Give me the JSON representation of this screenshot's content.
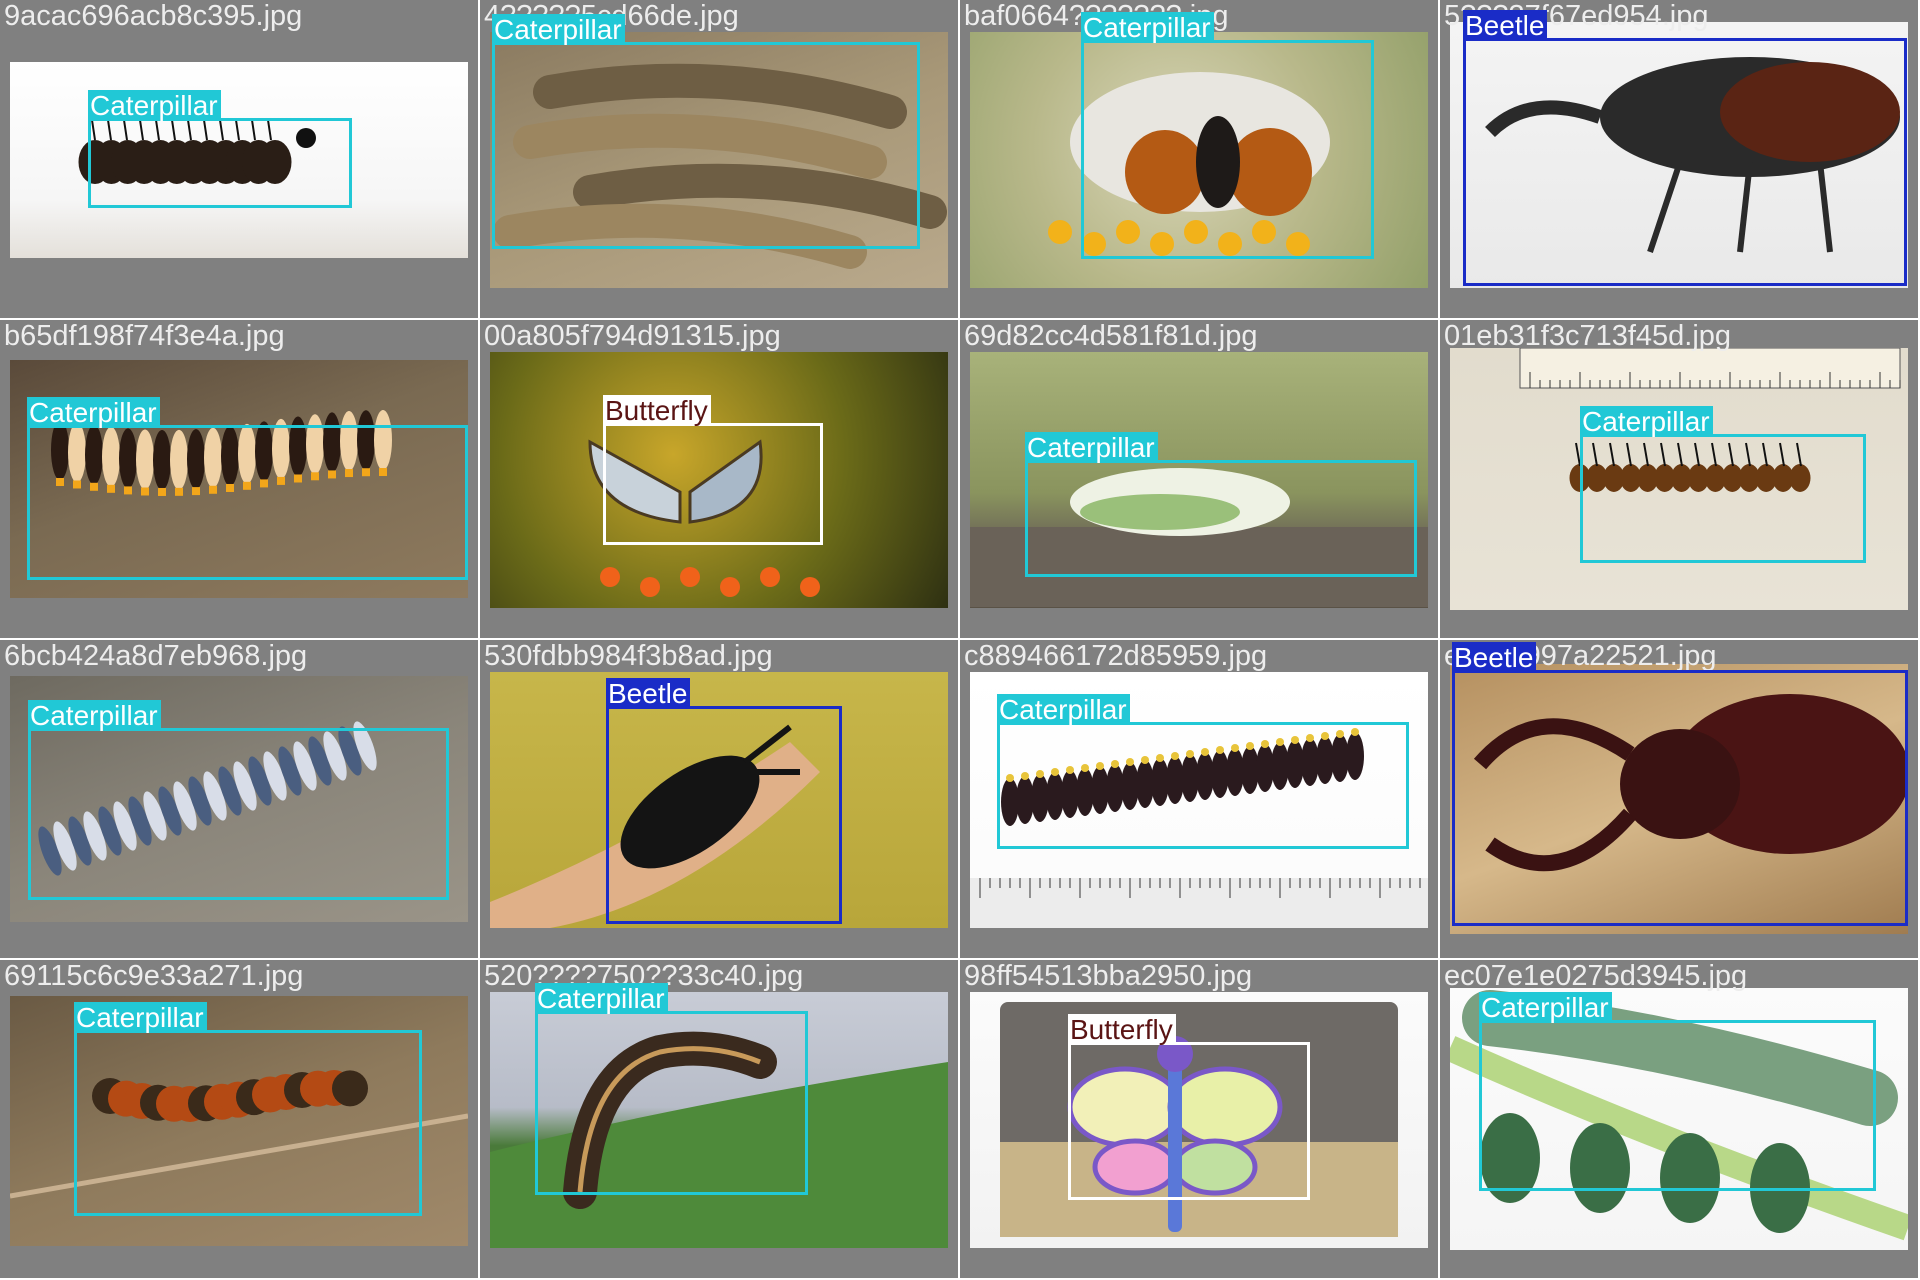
{
  "class_styles": {
    "Caterpillar": {
      "box": "#21c8d6",
      "label_bg": "#21c8d6",
      "label_fg": "#ffffff"
    },
    "Butterfly": {
      "box": "#ffffff",
      "label_bg": "#ffffff",
      "label_fg": "#5a1414"
    },
    "Beetle": {
      "box": "#1a2cc7",
      "label_bg": "#1a2cc7",
      "label_fg": "#ffffff"
    }
  },
  "tiles": [
    {
      "file": "9acac696acb8c395.jpg",
      "bg": "linear-gradient(180deg,#ffffff 0%,#f6f6f6 70%,#e4e0da 100%)",
      "subject": "spiky-caterpillar",
      "detections": [
        {
          "label": "Caterpillar"
        }
      ]
    },
    {
      "file": "4?????5cd66de.jpg",
      "bg": "linear-gradient(160deg,#8a7a60 0%,#a89878 50%,#b9a98c 100%)",
      "subject": "caterpillar-cluster",
      "detections": [
        {
          "label": "Caterpillar"
        }
      ]
    },
    {
      "file": "baf0664???????.jpg",
      "bg": "radial-gradient(circle at 45% 45%,#d9d6b8 0%,#b8b88a 50%,#93a06a 100%)",
      "subject": "woolly-caterpillar",
      "detections": [
        {
          "label": "Caterpillar"
        }
      ]
    },
    {
      "file": "5???37f67ed954.jpg",
      "bg": "linear-gradient(180deg,#f4f4f4 0%,#e9e9e9 100%)",
      "subject": "rhino-beetle",
      "detections": [
        {
          "label": "Beetle"
        }
      ]
    },
    {
      "file": "b65df198f74f3e4a.jpg",
      "bg": "linear-gradient(160deg,#5a4a3a 0%,#7a6a52 45%,#8e7a5e 100%)",
      "subject": "striped-millipede",
      "detections": [
        {
          "label": "Caterpillar"
        }
      ]
    },
    {
      "file": "00a805f794d91315.jpg",
      "bg": "radial-gradient(circle at 40% 40%,#c8a62a 0%,#6a6a18 55%,#2e3012 100%)",
      "subject": "morpho-butterfly",
      "detections": [
        {
          "label": "Butterfly"
        }
      ]
    },
    {
      "file": "69d82cc4d581f81d.jpg",
      "bg": "linear-gradient(180deg,#a8b27a 0%,#8a945e 55%,#6a6456 75%,#5a5246 100%)",
      "subject": "white-fuzzy-caterpillar",
      "detections": [
        {
          "label": "Caterpillar"
        }
      ]
    },
    {
      "file": "01eb31f3c713f45d.jpg",
      "bg": "linear-gradient(180deg,#e2dccd 0%,#e8e3d6 100%)",
      "subject": "ruler-caterpillar",
      "detections": [
        {
          "label": "Caterpillar"
        }
      ]
    },
    {
      "file": "6bcb424a8d7eb968.jpg",
      "bg": "linear-gradient(160deg,#6e6a60 0%,#8a857a 50%,#9a9488 100%)",
      "subject": "blue-millipede",
      "detections": [
        {
          "label": "Caterpillar"
        }
      ]
    },
    {
      "file": "530fdbb984f3b8ad.jpg",
      "bg": "linear-gradient(180deg,#c7b64a 0%,#b8a63a 100%)",
      "subject": "stag-beetle-finger",
      "detections": [
        {
          "label": "Beetle"
        }
      ]
    },
    {
      "file": "c889466172d85959.jpg",
      "bg": "linear-gradient(180deg,#ffffff 0%,#fbfbfb 100%)",
      "subject": "yellow-dot-millipede",
      "detections": [
        {
          "label": "Caterpillar"
        }
      ]
    },
    {
      "file": "e???9997a22521.jpg",
      "bg": "linear-gradient(160deg,#b59060 0%,#d6b88a 50%,#a07c50 100%)",
      "subject": "stag-beetle",
      "detections": [
        {
          "label": "Beetle"
        }
      ]
    },
    {
      "file": "69115c6c9e33a271.jpg",
      "bg": "linear-gradient(160deg,#6a5a44 0%,#8e7a5c 50%,#a0896a 100%)",
      "subject": "hairy-orange-caterpillar",
      "detections": [
        {
          "label": "Caterpillar"
        }
      ]
    },
    {
      "file": "520????750??33c40.jpg",
      "bg": "linear-gradient(180deg,#c8ccd6 0%,#b7bcc8 45%,#4a7a3a 60%,#5a8c44 100%)",
      "subject": "leaf-caterpillar",
      "detections": [
        {
          "label": "Caterpillar"
        }
      ]
    },
    {
      "file": "98ff54513bba2950.jpg",
      "bg": "linear-gradient(180deg,#fbfbfb 0%,#f2f2f2 100%)",
      "subject": "dragonfly-clip",
      "detections": [
        {
          "label": "Butterfly"
        }
      ]
    },
    {
      "file": "ec07e1e0275d3945.jpg",
      "bg": "linear-gradient(180deg,#fbfbfb 0%,#f5f5f5 100%)",
      "subject": "green-caterpillar",
      "detections": [
        {
          "label": "Caterpillar"
        }
      ]
    }
  ]
}
